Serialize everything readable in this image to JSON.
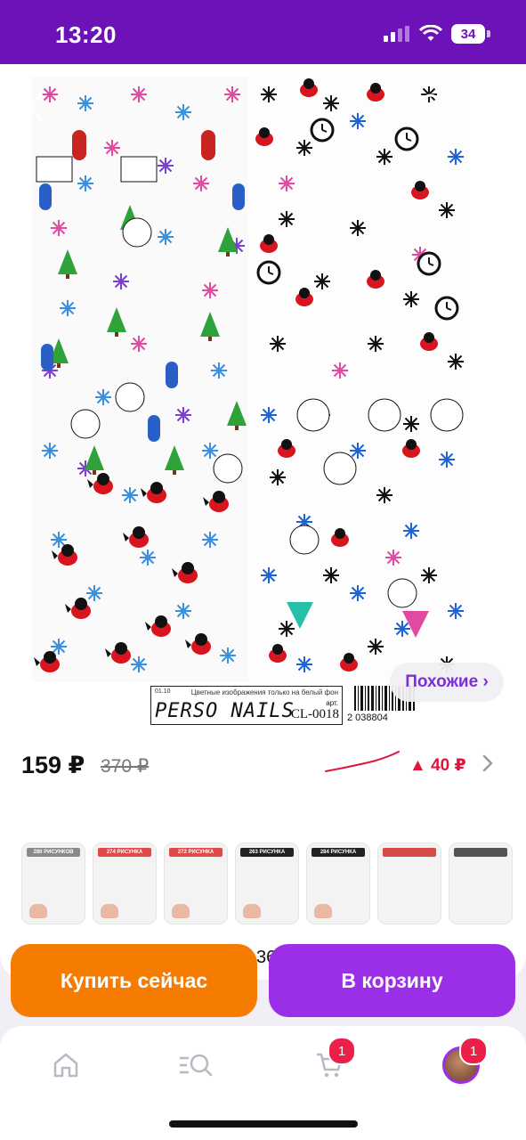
{
  "status_bar": {
    "time": "13:20",
    "battery": "34"
  },
  "product": {
    "label": {
      "small_code": "01.10",
      "note": "Цветные изображения только на белый фон",
      "brand": "PERSO NAILS",
      "article_prefix": "арт.",
      "article": "CL-0018",
      "barcode_number": "2 038804"
    },
    "similar_button": "Похожие ›",
    "price": "159 ₽",
    "old_price": "370 ₽",
    "price_change": "▲ 40 ₽"
  },
  "variants": [
    {
      "title": "280 РИСУНКОВ",
      "color": "#8a8a8a"
    },
    {
      "title": "274 РИСУНКА",
      "color": "#e24a4a"
    },
    {
      "title": "272 РИСУНКА",
      "color": "#e24a4a"
    },
    {
      "title": "263 РИСУНКА",
      "color": "#222222"
    },
    {
      "title": "284 РИСУНКА",
      "color": "#222222"
    },
    {
      "title": "",
      "color": "#d64a4a"
    },
    {
      "title": "",
      "color": "#555555"
    }
  ],
  "peek_text": "36",
  "actions": {
    "buy_now": "Купить сейчас",
    "add_to_cart": "В корзину"
  },
  "tabbar": {
    "cart_badge": "1",
    "profile_badge": "1"
  },
  "colors": {
    "brand": "#6d12b8",
    "buy": "#f57c00",
    "cart": "#9b2fe8",
    "accent_text": "#7b2fd6",
    "price_up": "#e0143c"
  }
}
